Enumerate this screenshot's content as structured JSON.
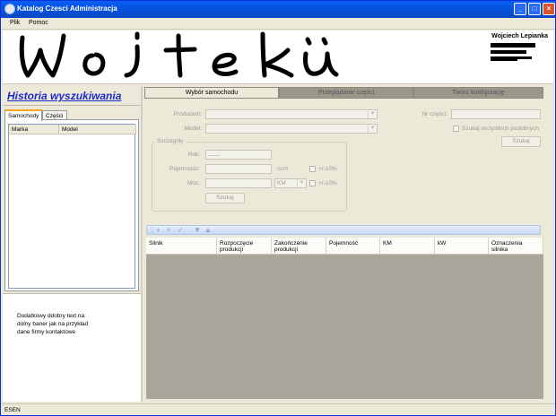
{
  "window": {
    "title": "Katalog Czesci Administracja",
    "minimize": "_",
    "maximize": "□",
    "close": "×"
  },
  "menu": {
    "items": [
      "Plik",
      "Pomoc"
    ]
  },
  "banner": {
    "author": "Wojciech Lepianka"
  },
  "history": {
    "title": "Historia wyszukiwania",
    "tabs": [
      "Samochody",
      "Części"
    ],
    "columns": [
      "Marka",
      "Model"
    ],
    "info": "Dodatkowy ddobry text na\ndolny baner jak na przykład\ndane firmy kontaktowe"
  },
  "main_tabs": [
    "Wybór samochodu",
    "Przeglądanie części",
    "Twórz konfigurację"
  ],
  "form": {
    "producent_label": "Producent:",
    "model_label": "Model:",
    "nr_czesci_label": "Nr części:",
    "all_subsets_label": "Szukaj wszystkich podobnych",
    "search_button": "Szukaj",
    "details": {
      "title": "Szczegóły",
      "rok_label": "Rok:",
      "rok_value": "____",
      "pojemnosc_label": "Pojemność:",
      "pojemnosc_unit": "ccm",
      "tolerance": "+/-10%",
      "moc_label": "Moc:",
      "moc_unit": "KM",
      "search_button": "Szukaj"
    }
  },
  "toolbar": {
    "icons": [
      "+",
      "×",
      "✓",
      "▼",
      "▲"
    ]
  },
  "grid": {
    "columns": [
      "Silnik",
      "Rozpoczęcie produkcji",
      "Zakończenie produkcji",
      "Pojemność",
      "KM",
      "kW",
      "Oznaczenia silnika"
    ]
  },
  "status": {
    "text": "ESEN"
  }
}
